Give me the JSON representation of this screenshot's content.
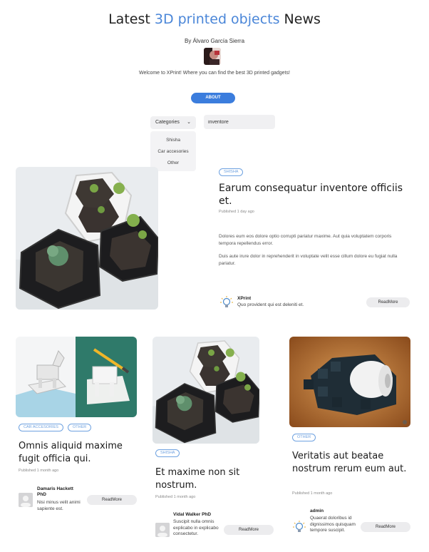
{
  "header": {
    "title_prefix": "Latest ",
    "title_accent": "3D printed objects",
    "title_suffix": " News",
    "byline": "By Álvaro García Sierra",
    "welcome": "Welcome to XPrint! Where you can find the best 3D printed gadgets!",
    "about_label": "ABOUT"
  },
  "filters": {
    "categories_label": "Categories",
    "categories_options": [
      "Shisha",
      "Car accesories",
      "Other"
    ],
    "search_value": "inventore"
  },
  "featured": {
    "badge": "SHISHA",
    "title": "Earum consequatur inventore officiis et.",
    "published": "Published 1 day ago",
    "paragraph1": "Dolores eum eos dolore optio corrupti pariatur maxime. Aut quia voluptatem corporis tempora repellendus error.",
    "paragraph2": "Duis aute irure dolor in reprehenderit in voluptate velit esse cillum dolore eu fugiat nulla pariatur.",
    "author_name": "XPrint",
    "author_desc": "Quo provident qui est deleniti et.",
    "readmore": "ReadMore"
  },
  "cards": [
    {
      "badges": [
        "CAR ACCESORIES",
        "OTHER"
      ],
      "title": "Omnis aliquid maxime fugit officia qui.",
      "published": "Published 1 month ago",
      "author_name": "Damaris Hackett PhD",
      "author_desc": "Nisi minus velit animi sapiente est.",
      "readmore": "ReadMore"
    },
    {
      "badges": [
        "SHISHA"
      ],
      "title": "Et maxime non sit nostrum.",
      "published": "Published 1 month ago",
      "author_name": "Vidal Walker PhD",
      "author_desc": "Suscipit nulla omnis explicabo in explicabo consectetur.",
      "readmore": "ReadMore"
    },
    {
      "badges": [
        "OTHER"
      ],
      "title": "Veritatis aut beatae nostrum rerum eum aut.",
      "published": "Published 1 month ago",
      "author_name": "admin",
      "author_desc": "Quaerat doloribus id dignissimos quisquam tempore suscipit.",
      "readmore": "ReadMore"
    }
  ]
}
